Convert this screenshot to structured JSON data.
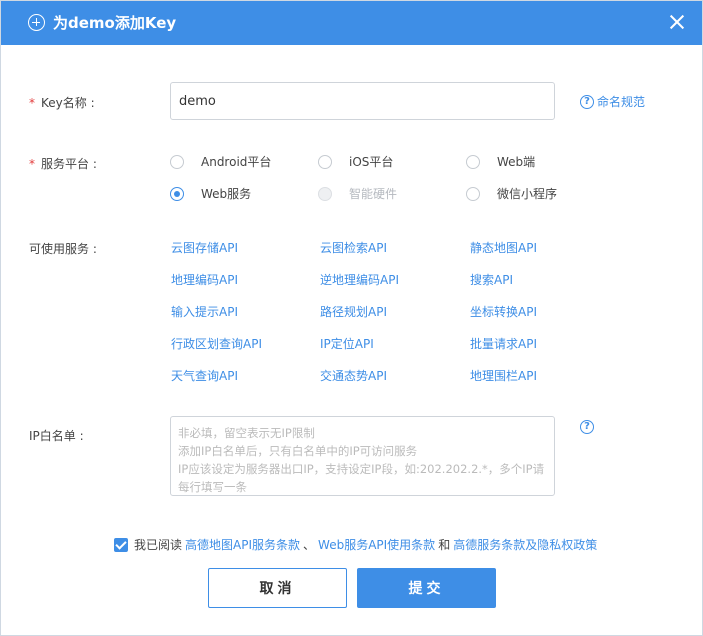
{
  "dialog": {
    "title": "为demo添加Key",
    "close_icon": "close-icon",
    "title_icon": "plus-circle-icon"
  },
  "form": {
    "key_name": {
      "required_mark": "*",
      "label": "Key名称 :",
      "value": "demo",
      "help_text": "命名规范"
    },
    "platform": {
      "required_mark": "*",
      "label": "服务平台 :",
      "options": [
        {
          "label": "Android平台",
          "state": "unchecked"
        },
        {
          "label": "iOS平台",
          "state": "unchecked"
        },
        {
          "label": "Web端",
          "state": "unchecked"
        },
        {
          "label": "Web服务",
          "state": "checked"
        },
        {
          "label": "智能硬件",
          "state": "disabled"
        },
        {
          "label": "微信小程序",
          "state": "unchecked"
        }
      ]
    },
    "services": {
      "label": "可使用服务 :",
      "items": [
        "云图存储API",
        "云图检索API",
        "静态地图API",
        "地理编码API",
        "逆地理编码API",
        "搜索API",
        "输入提示API",
        "路径规划API",
        "坐标转换API",
        "行政区划查询API",
        "IP定位API",
        "批量请求API",
        "天气查询API",
        "交通态势API",
        "地理围栏API"
      ]
    },
    "ip_whitelist": {
      "label": "IP白名单 :",
      "placeholder_lines": [
        "非必填，留空表示无IP限制",
        "添加IP白名单后，只有白名单中的IP可访问服务",
        "IP应该设定为服务器出口IP，支持设定IP段，如:202.202.2.*，多个IP请",
        "每行填写一条"
      ]
    },
    "agreement": {
      "prefix": "我已阅读",
      "link1": "高德地图API服务条款",
      "sep1": "、",
      "link2": "Web服务API使用条款",
      "sep2": "和",
      "link3": "高德服务条款及隐私权政策",
      "checked": true
    }
  },
  "buttons": {
    "cancel": "取消",
    "submit": "提交"
  },
  "colors": {
    "accent": "#3e8ee6",
    "required": "#e23b3b"
  }
}
